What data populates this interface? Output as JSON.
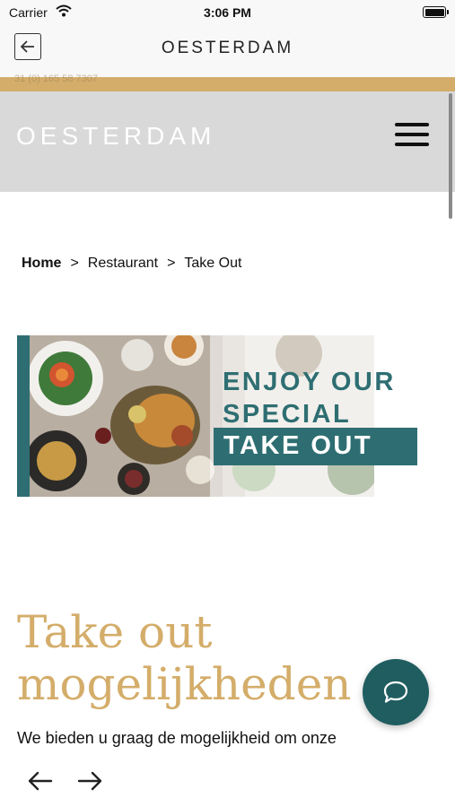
{
  "status_bar": {
    "carrier": "Carrier",
    "time": "3:06 PM"
  },
  "app_bar": {
    "title": "OESTERDAM"
  },
  "top_strip": {
    "phone": "31 (0) 165 58 7307"
  },
  "site_header": {
    "logo": "OESTERDAM"
  },
  "breadcrumb": {
    "items": [
      "Home",
      "Restaurant",
      "Take Out"
    ],
    "separator": ">"
  },
  "banner": {
    "line1": "ENJOY OUR",
    "line2": "SPECIAL",
    "line3": "TAKE OUT"
  },
  "content": {
    "heading_line1": "Take out",
    "heading_line2": "mogelijkheden",
    "intro": "We bieden u graag de mogelijkheid om onze"
  },
  "colors": {
    "gold": "#d4ad6a",
    "teal": "#2e6e72",
    "chat": "#1f5d60"
  },
  "icons": [
    "back-arrow-icon",
    "wifi-icon",
    "battery-icon",
    "menu-icon",
    "chat-icon",
    "arrow-left-icon",
    "arrow-right-icon"
  ]
}
